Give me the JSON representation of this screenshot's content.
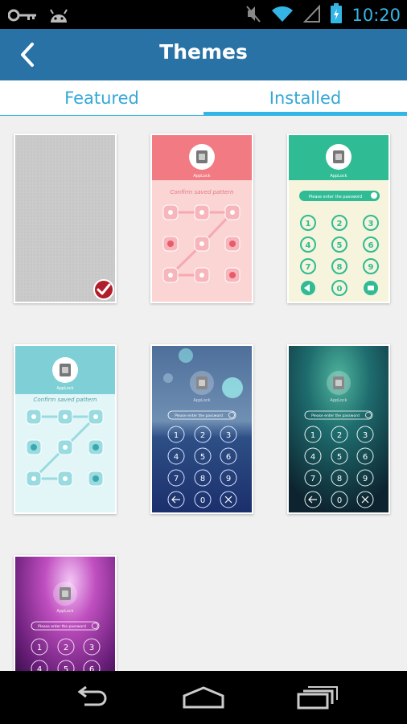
{
  "status_bar": {
    "time": "10:20",
    "icons": [
      "key-icon",
      "android-icon",
      "mute-icon",
      "wifi-icon",
      "signal-icon",
      "battery-icon"
    ]
  },
  "header": {
    "title": "Themes",
    "back_icon": "back-arrow-icon"
  },
  "tabs": [
    {
      "label": "Featured",
      "selected": false
    },
    {
      "label": "Installed",
      "selected": true
    }
  ],
  "themes": [
    {
      "name": "gray-linen",
      "selected": true
    },
    {
      "name": "pink-pattern",
      "caption": "Confirm saved pattern",
      "selected": false
    },
    {
      "name": "green-pin",
      "placeholder": "Please enter the password",
      "keys": [
        "1",
        "2",
        "3",
        "4",
        "5",
        "6",
        "7",
        "8",
        "9",
        "0"
      ],
      "selected": false
    },
    {
      "name": "teal-pattern",
      "caption": "Confirm saved pattern",
      "selected": false
    },
    {
      "name": "blue-bokeh-pin",
      "placeholder": "Please enter the password",
      "keys": [
        "1",
        "2",
        "3",
        "4",
        "5",
        "6",
        "7",
        "8",
        "9",
        "0"
      ],
      "selected": false
    },
    {
      "name": "teal-galaxy-pin",
      "placeholder": "Please enter the password",
      "keys": [
        "1",
        "2",
        "3",
        "4",
        "5",
        "6",
        "7",
        "8",
        "9",
        "0"
      ],
      "selected": false
    },
    {
      "name": "purple-aurora-pin",
      "placeholder": "Please enter the password",
      "keys": [
        "1",
        "2",
        "3",
        "4",
        "5",
        "6"
      ],
      "selected": false
    }
  ],
  "app_label": "AppLock",
  "colors": {
    "app_bar": "#2872a6",
    "accent": "#33b5e5",
    "check": "#b11e2b"
  },
  "nav_bar": {
    "icons": [
      "back-nav-icon",
      "home-nav-icon",
      "recents-nav-icon"
    ]
  }
}
